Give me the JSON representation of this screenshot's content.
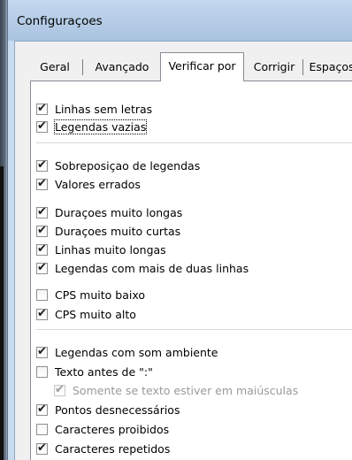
{
  "window": {
    "title": "Configuraçoes"
  },
  "tabs": [
    {
      "label": "Geral",
      "active": false
    },
    {
      "label": "Avançado",
      "active": false
    },
    {
      "label": "Verificar por",
      "active": true
    },
    {
      "label": "Corrigir",
      "active": false
    },
    {
      "label": "Espaços",
      "active": false
    }
  ],
  "checks": [
    {
      "label": "Linhas sem letras",
      "checked": true,
      "enabled": true
    },
    {
      "label": "Legendas vazias",
      "checked": true,
      "enabled": true,
      "focused": true
    },
    {
      "label": "Sobreposiçao de legendas",
      "checked": true,
      "enabled": true
    },
    {
      "label": "Valores errados",
      "checked": true,
      "enabled": true
    },
    {
      "label": "Duraçoes muito longas",
      "checked": true,
      "enabled": true
    },
    {
      "label": "Duraçoes muito curtas",
      "checked": true,
      "enabled": true
    },
    {
      "label": "Linhas muito longas",
      "checked": true,
      "enabled": true
    },
    {
      "label": "Legendas com mais de duas linhas",
      "checked": true,
      "enabled": true
    },
    {
      "label": "CPS muito baixo",
      "checked": false,
      "enabled": true
    },
    {
      "label": "CPS muito alto",
      "checked": true,
      "enabled": true
    },
    {
      "label": "Legendas com som ambiente",
      "checked": true,
      "enabled": true
    },
    {
      "label": "Texto antes de \":\"",
      "checked": false,
      "enabled": true
    },
    {
      "label": "Somente se texto estiver em maiúsculas",
      "checked": true,
      "enabled": false
    },
    {
      "label": "Pontos desnecessários",
      "checked": true,
      "enabled": true
    },
    {
      "label": "Caracteres proibidos",
      "checked": false,
      "enabled": true
    },
    {
      "label": "Caracteres repetidos",
      "checked": true,
      "enabled": true
    }
  ],
  "check_mark": "✔"
}
